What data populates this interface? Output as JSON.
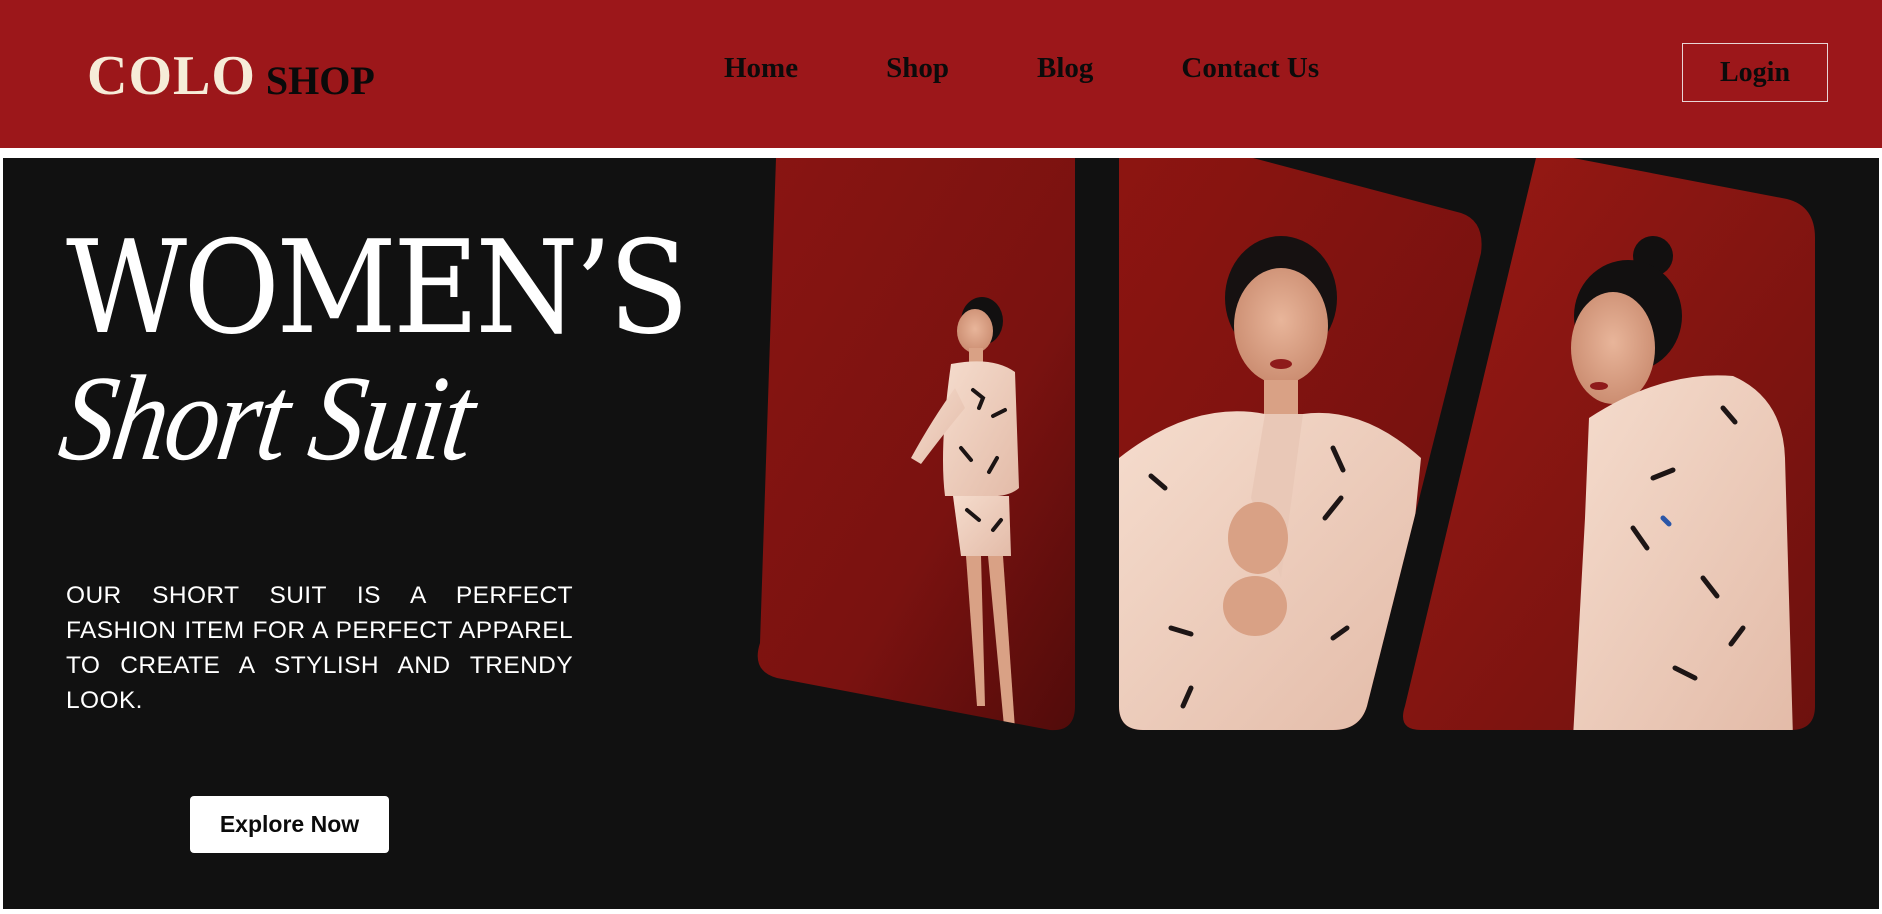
{
  "brand": {
    "name_primary": "COLO",
    "name_secondary": "SHOP"
  },
  "nav": {
    "links": [
      "Home",
      "Shop",
      "Blog",
      "Contact Us"
    ],
    "login_label": "Login"
  },
  "hero": {
    "title": "WOMEN’S",
    "subtitle": "Short Suit",
    "description": "OUR SHORT SUIT IS A PERFECT FASHION ITEM FOR A PERFECT APPAREL TO CREATE A STYLISH AND TRENDY LOOK.",
    "cta_label": "Explore Now"
  },
  "colors": {
    "header_bg": "#9c171a",
    "hero_bg": "#111111",
    "logo_light": "#f6ecd8",
    "photo_backdrop": "#8e1512",
    "suit": "#f1d3c3"
  }
}
